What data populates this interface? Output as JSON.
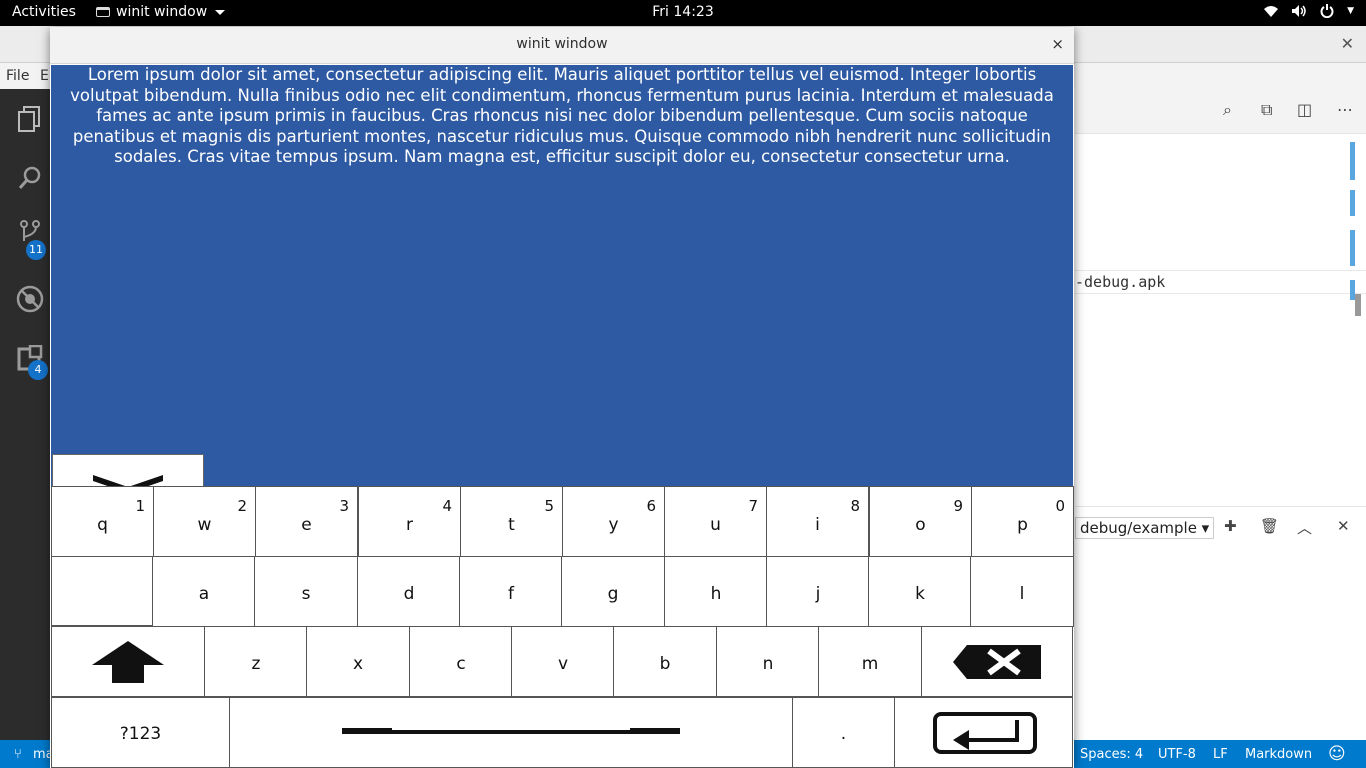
{
  "topbar": {
    "activities": "Activities",
    "app_name": "winit window",
    "clock": "Fri 14:23",
    "tray_icons": [
      "wifi-icon",
      "volume-icon",
      "power-icon"
    ]
  },
  "vscode": {
    "menu": [
      "File",
      "E"
    ],
    "activity_badges": {
      "source_control": "11",
      "extensions": "4"
    },
    "editor_line": "-debug.apk",
    "panel_select": "debug/example ▾",
    "status": {
      "left": "ma",
      "spaces": "Spaces: 4",
      "encoding": "UTF-8",
      "eol": "LF",
      "language": "Markdown"
    }
  },
  "winit": {
    "title": "winit window",
    "close": "×",
    "background_color": "#2e5aa3",
    "text": "Lorem ipsum dolor sit amet, consectetur adipiscing elit. Mauris aliquet porttitor tellus vel euismod. Integer lobortis volutpat bibendum. Nulla finibus odio nec elit condimentum, rhoncus fermentum purus lacinia. Interdum et malesuada fames ac ante ipsum primis in faucibus. Cras rhoncus nisi nec dolor bibendum pellentesque. Cum sociis natoque penatibus et magnis dis parturient montes, nascetur ridiculus mus. Quisque commodo nibh hendrerit nunc sollicitudin sodales. Cras vitae tempus ipsum. Nam magna est, efficitur suscipit dolor eu, consectetur consectetur urna."
  },
  "keyboard": {
    "row1": [
      {
        "key": "q",
        "num": "1"
      },
      {
        "key": "w",
        "num": "2"
      },
      {
        "key": "e",
        "num": "3"
      },
      {
        "key": "r",
        "num": "4"
      },
      {
        "key": "t",
        "num": "5"
      },
      {
        "key": "y",
        "num": "6"
      },
      {
        "key": "u",
        "num": "7"
      },
      {
        "key": "i",
        "num": "8"
      },
      {
        "key": "o",
        "num": "9"
      },
      {
        "key": "p",
        "num": "0"
      }
    ],
    "row2": [
      "a",
      "s",
      "d",
      "f",
      "g",
      "h",
      "j",
      "k",
      "l"
    ],
    "row3": [
      "z",
      "x",
      "c",
      "v",
      "b",
      "n",
      "m"
    ],
    "symbols_label": "?123",
    "period_label": "."
  }
}
